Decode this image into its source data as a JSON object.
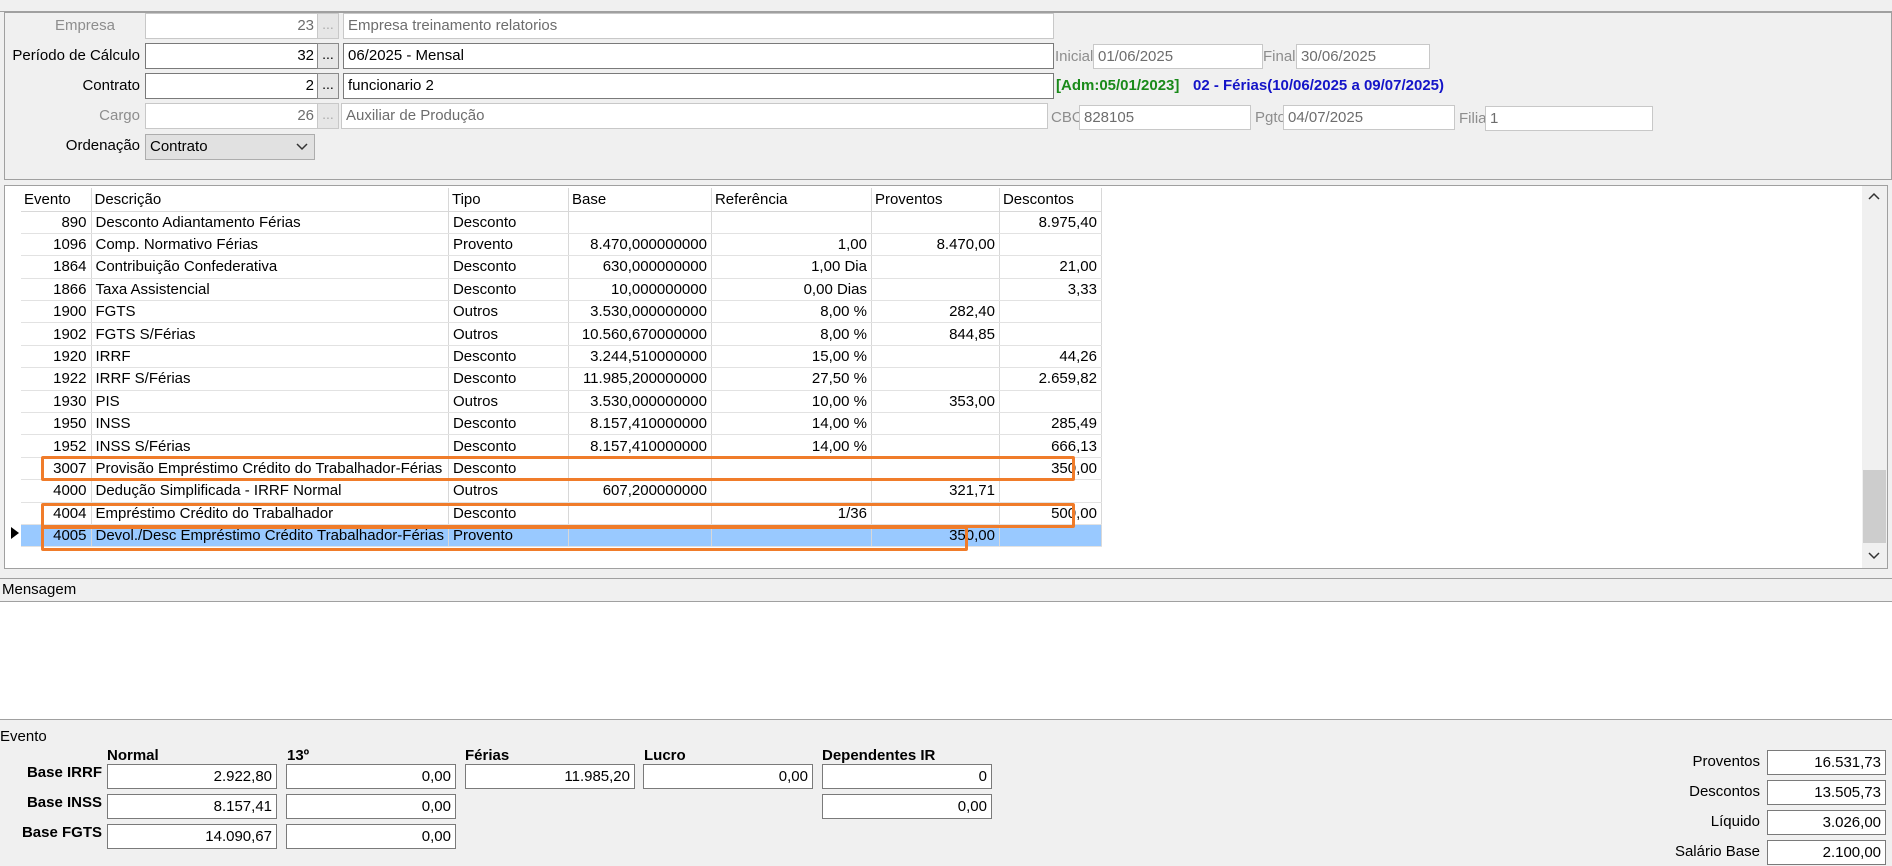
{
  "header": {
    "empresa": {
      "label": "Empresa",
      "code": "23",
      "name": "Empresa treinamento relatorios"
    },
    "periodo": {
      "label": "Período de Cálculo",
      "code": "32",
      "name": "06/2025 - Mensal",
      "inicial_label": "Inicial",
      "inicial": "01/06/2025",
      "final_label": "Final",
      "final": "30/06/2025"
    },
    "contrato": {
      "label": "Contrato",
      "code": "2",
      "name": "funcionario 2",
      "adm": "[Adm:05/01/2023]",
      "ferias": "02 - Férias(10/06/2025 a 09/07/2025)"
    },
    "cargo": {
      "label": "Cargo",
      "code": "26",
      "name": "Auxiliar de Produção",
      "cbo_label": "CBO",
      "cbo": "828105",
      "pgto_label": "Pgto",
      "pgto": "04/07/2025",
      "filial_label": "Filial",
      "filial": "1"
    },
    "ordenacao": {
      "label": "Ordenação",
      "value": "Contrato"
    },
    "lookup_glyph": "...",
    "colors": {
      "adm": "#1a8a1a",
      "ferias": "#1414c8",
      "highlight": "#f07c2a",
      "selected_row": "#99c9ff"
    }
  },
  "grid": {
    "columns": [
      "Evento",
      "Descrição",
      "Tipo",
      "Base",
      "Referência",
      "Proventos",
      "Descontos"
    ],
    "rows": [
      [
        "890",
        "Desconto Adiantamento Férias",
        "Desconto",
        "",
        "",
        "",
        "8.975,40"
      ],
      [
        "1096",
        "Comp. Normativo Férias",
        "Provento",
        "8.470,000000000",
        "1,00",
        "8.470,00",
        ""
      ],
      [
        "1864",
        "Contribuição Confederativa",
        "Desconto",
        "630,000000000",
        "1,00 Dia",
        "",
        "21,00"
      ],
      [
        "1866",
        "Taxa Assistencial",
        "Desconto",
        "10,000000000",
        "0,00 Dias",
        "",
        "3,33"
      ],
      [
        "1900",
        "FGTS",
        "Outros",
        "3.530,000000000",
        "8,00 %",
        "282,40",
        ""
      ],
      [
        "1902",
        "FGTS S/Férias",
        "Outros",
        "10.560,670000000",
        "8,00 %",
        "844,85",
        ""
      ],
      [
        "1920",
        "IRRF",
        "Desconto",
        "3.244,510000000",
        "15,00 %",
        "",
        "44,26"
      ],
      [
        "1922",
        "IRRF S/Férias",
        "Desconto",
        "11.985,200000000",
        "27,50 %",
        "",
        "2.659,82"
      ],
      [
        "1930",
        "PIS",
        "Outros",
        "3.530,000000000",
        "10,00 %",
        "353,00",
        ""
      ],
      [
        "1950",
        "INSS",
        "Desconto",
        "8.157,410000000",
        "14,00 %",
        "",
        "285,49"
      ],
      [
        "1952",
        "INSS S/Férias",
        "Desconto",
        "8.157,410000000",
        "14,00 %",
        "",
        "666,13"
      ],
      [
        "3007",
        "Provisão Empréstimo Crédito do Trabalhador-Férias",
        "Desconto",
        "",
        "",
        "",
        "350,00"
      ],
      [
        "4000",
        "Dedução Simplificada - IRRF Normal",
        "Outros",
        "607,200000000",
        "",
        "321,71",
        ""
      ],
      [
        "4004",
        "Empréstimo Crédito do Trabalhador",
        "Desconto",
        "",
        "1/36",
        "",
        "500,00"
      ],
      [
        "4005",
        "Devol./Desc Empréstimo Crédito Trabalhador-Férias",
        "Provento",
        "",
        "",
        "350,00",
        ""
      ]
    ],
    "selected_row": 14
  },
  "mensagem": {
    "label": "Mensagem"
  },
  "evento": {
    "label": "Evento",
    "col_headers": [
      "Normal",
      "13º",
      "Férias",
      "Lucro",
      "Dependentes IR"
    ],
    "base_irrf": {
      "label": "Base IRRF",
      "normal": "2.922,80",
      "decimo": "0,00",
      "ferias": "11.985,20",
      "lucro": "0,00",
      "dependentes": "0"
    },
    "base_inss": {
      "label": "Base INSS",
      "normal": "8.157,41",
      "decimo": "0,00",
      "dependentes": "0,00"
    },
    "base_fgts": {
      "label": "Base FGTS",
      "normal": "14.090,67",
      "decimo": "0,00"
    }
  },
  "totals": {
    "proventos": {
      "label": "Proventos",
      "value": "16.531,73"
    },
    "descontos": {
      "label": "Descontos",
      "value": "13.505,73"
    },
    "liquido": {
      "label": "Líquido",
      "value": "3.026,00"
    },
    "salario_base": {
      "label": "Salário Base",
      "value": "2.100,00"
    }
  }
}
